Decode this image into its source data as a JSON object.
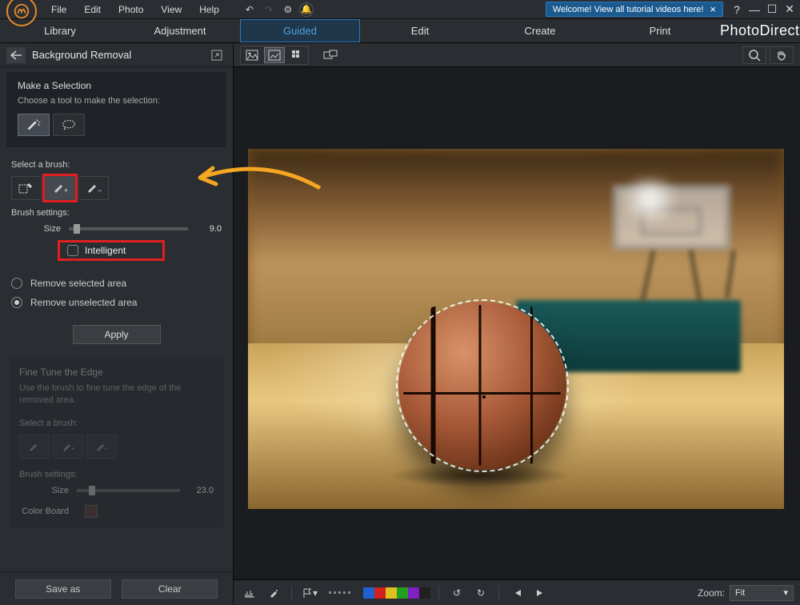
{
  "menubar": {
    "file": "File",
    "edit": "Edit",
    "photo": "Photo",
    "view": "View",
    "help": "Help"
  },
  "banner": {
    "text": "Welcome! View all tutorial videos here!"
  },
  "window": {
    "help": "?"
  },
  "tabs": {
    "library": "Library",
    "adjustment": "Adjustment",
    "guided": "Guided",
    "edit2": "Edit",
    "create": "Create",
    "print": "Print"
  },
  "brand": "PhotoDirector",
  "panel": {
    "title": "Background Removal",
    "make_selection": "Make a Selection",
    "choose_tool": "Choose a tool to make the selection:",
    "select_brush": "Select a brush:",
    "brush_settings": "Brush settings:",
    "size_label": "Size",
    "size_value": "9.0",
    "intelligent": "Intelligent",
    "remove_selected": "Remove selected area",
    "remove_unselected": "Remove unselected area",
    "apply": "Apply",
    "fine_tune": "Fine Tune the Edge",
    "fine_tune_sub": "Use the brush to fine tune the edge of the removed area.",
    "ft_select_brush": "Select a brush:",
    "ft_brush_settings": "Brush settings:",
    "ft_size_label": "Size",
    "ft_size_value": "23.0",
    "color_board": "Color Board",
    "save_as": "Save as",
    "clear": "Clear"
  },
  "bottombar": {
    "zoom_label": "Zoom:",
    "zoom_value": "Fit",
    "palette": [
      "#2060d0",
      "#d02020",
      "#e0c020",
      "#20a020",
      "#8020c0",
      "#202020"
    ]
  }
}
